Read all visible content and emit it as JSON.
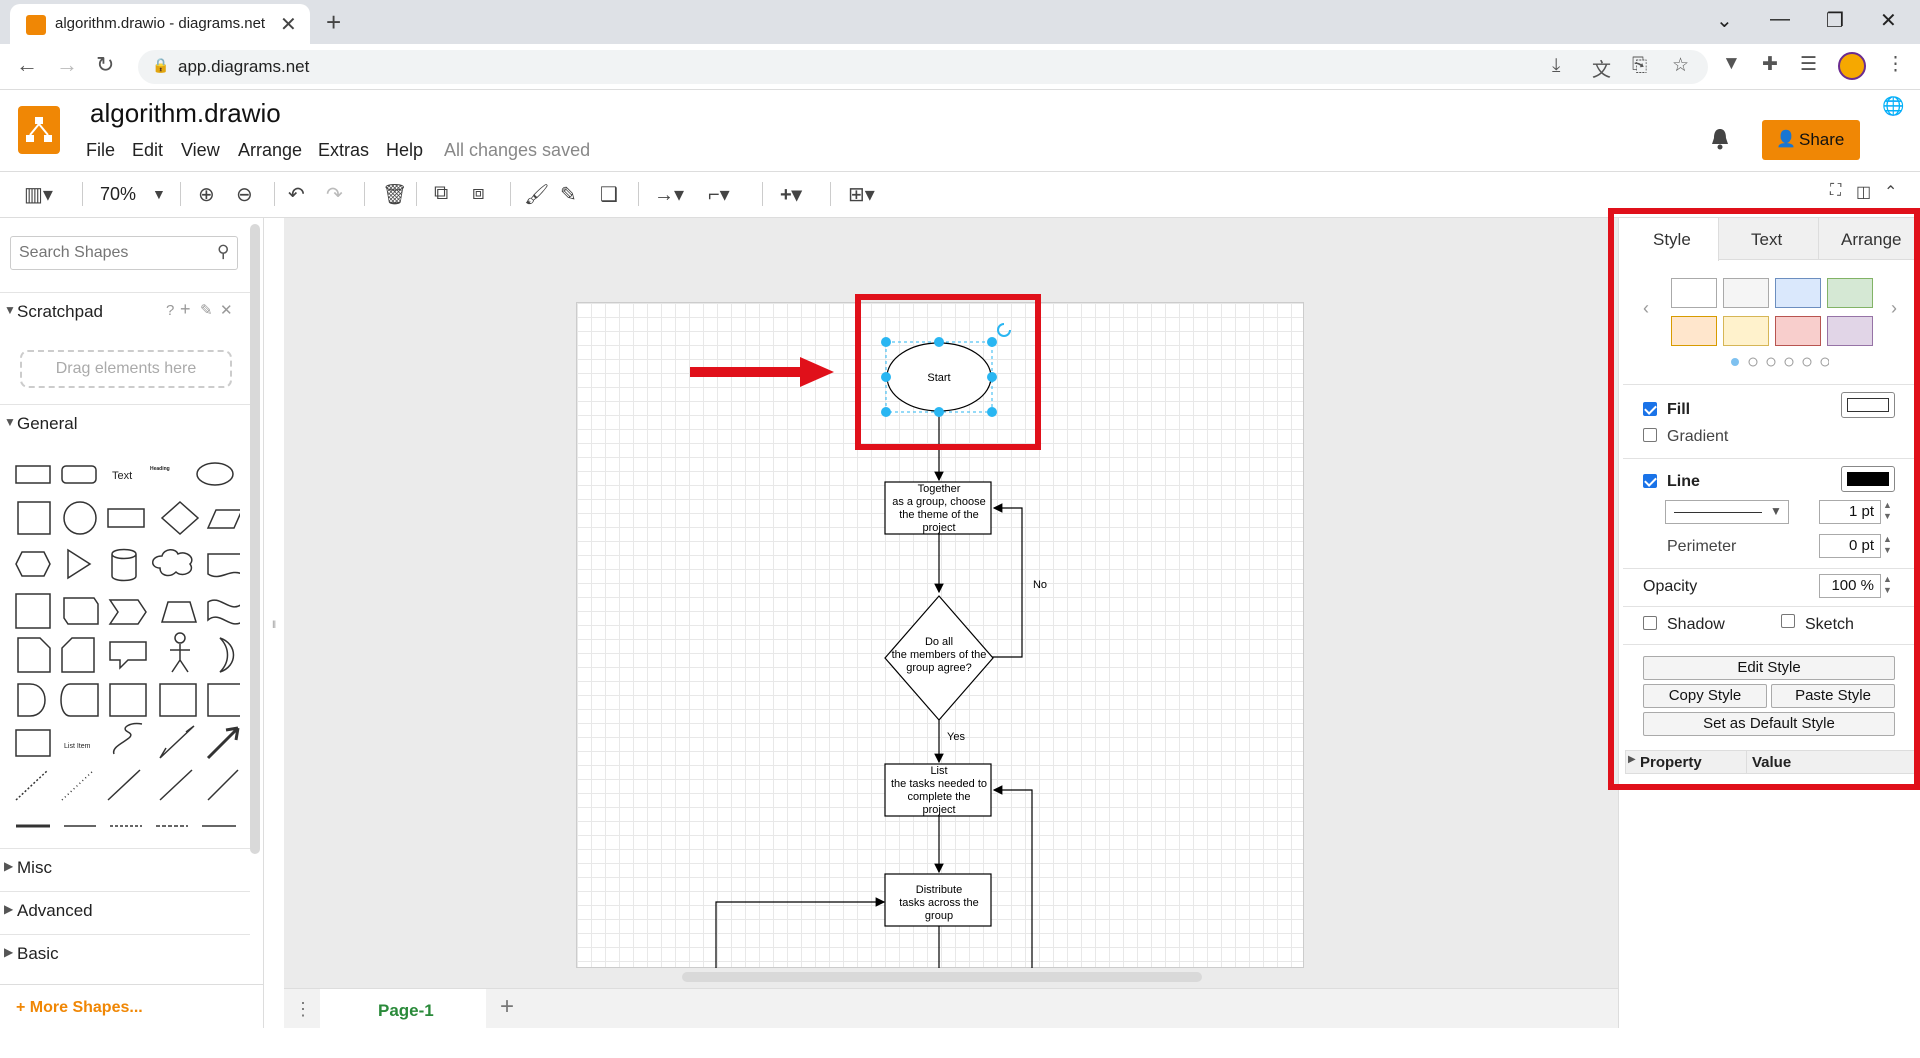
{
  "browser": {
    "tab_title": "algorithm.drawio - diagrams.net",
    "url": "app.diagrams.net"
  },
  "app": {
    "doc_title": "algorithm.drawio",
    "menus": [
      "File",
      "Edit",
      "View",
      "Arrange",
      "Extras",
      "Help"
    ],
    "save_status": "All changes saved",
    "share_label": "Share"
  },
  "toolbar": {
    "zoom": "70%"
  },
  "sidebar": {
    "search_placeholder": "Search Shapes",
    "scratchpad": "Scratchpad",
    "drop_hint": "Drag elements here",
    "general": "General",
    "sections": [
      "Misc",
      "Advanced",
      "Basic"
    ],
    "more_shapes": "+ More Shapes...",
    "shape_text": "Text",
    "shape_heading": "Heading",
    "shape_list_item": "List Item"
  },
  "diagram": {
    "start": "Start",
    "step1": [
      "Together",
      "as a group, choose",
      "the theme of the",
      "project"
    ],
    "decision": [
      "Do all",
      "the members of the",
      "group agree?"
    ],
    "no_label": "No",
    "yes_label": "Yes",
    "step2": [
      "List",
      "the tasks needed to",
      "complete the",
      "project"
    ],
    "step3": [
      "Distribute",
      "tasks across the",
      "group"
    ]
  },
  "pages": {
    "page1": "Page-1"
  },
  "format_panel": {
    "tabs": [
      "Style",
      "Text",
      "Arrange"
    ],
    "fill_label": "Fill",
    "gradient_label": "Gradient",
    "line_label": "Line",
    "line_width": "1 pt",
    "perimeter_label": "Perimeter",
    "perimeter_value": "0 pt",
    "opacity_label": "Opacity",
    "opacity_value": "100 %",
    "shadow_label": "Shadow",
    "sketch_label": "Sketch",
    "edit_style": "Edit Style",
    "copy_style": "Copy Style",
    "paste_style": "Paste Style",
    "set_default": "Set as Default Style",
    "prop_header": "Property",
    "value_header": "Value",
    "swatches": [
      "#ffffff",
      "#f5f5f5",
      "#dae8fc",
      "#d5e8d4",
      "#ffe6cc",
      "#fff2cc",
      "#f8cecc",
      "#e1d5e7"
    ]
  }
}
